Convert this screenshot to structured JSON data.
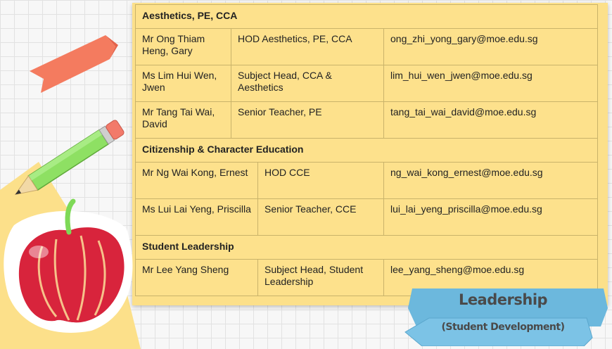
{
  "sections": [
    {
      "heading": "Aesthetics, PE, CCA",
      "rows": [
        {
          "name": "Mr Ong Thiam Heng, Gary",
          "role": "HOD Aesthetics, PE, CCA",
          "email": "ong_zhi_yong_gary@moe.edu.sg"
        },
        {
          "name": "Ms Lim Hui Wen, Jwen",
          "role": "Subject Head, CCA & Aesthetics",
          "email": "lim_hui_wen_jwen@moe.edu.sg"
        },
        {
          "name": "Mr Tang Tai Wai, David",
          "role": "Senior Teacher, PE",
          "email": "tang_tai_wai_david@moe.edu.sg"
        }
      ]
    },
    {
      "heading": "Citizenship & Character Education",
      "rows": [
        {
          "name": "Mr Ng Wai Kong, Ernest",
          "role": "HOD CCE",
          "email": "ng_wai_kong_ernest@moe.edu.sg"
        },
        {
          "name": "Ms Lui Lai Yeng, Priscilla",
          "role": "Senior Teacher, CCE",
          "email": "lui_lai_yeng_priscilla@moe.edu.sg"
        }
      ]
    },
    {
      "heading": "Student Leadership",
      "rows": [
        {
          "name": "Mr Lee Yang Sheng",
          "role": "Subject Head, Student Leadership",
          "email": "lee_yang_sheng@moe.edu.sg"
        }
      ]
    }
  ],
  "banner": {
    "title": "Leadership",
    "subtitle": "(Student Development)"
  },
  "colors": {
    "note": "#fde18c",
    "ribbon": "#6cb8dd",
    "ribbon_arrow": "#f47b5f",
    "pencil": "#7ed957",
    "apple": "#d8243c"
  },
  "icons": [
    "arrow-ribbon-icon",
    "pencil-icon",
    "apple-icon"
  ]
}
